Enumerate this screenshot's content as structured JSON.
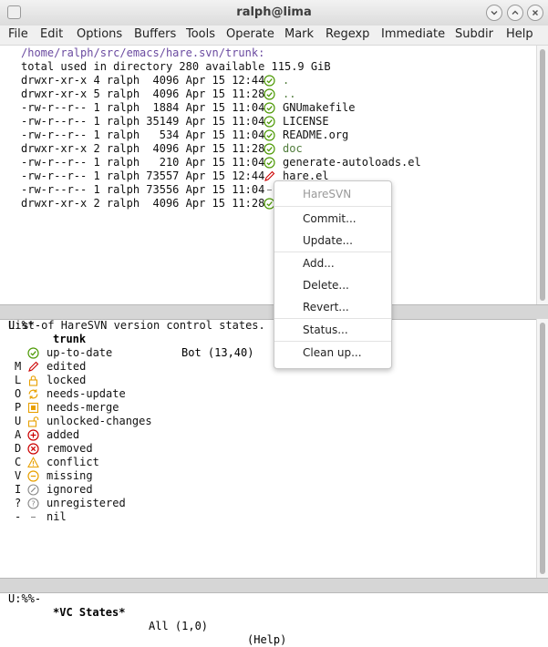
{
  "window": {
    "title": "ralph@lima"
  },
  "menu": [
    "File",
    "Edit",
    "Options",
    "Buffers",
    "Tools",
    "Operate",
    "Mark",
    "Regexp",
    "Immediate",
    "Subdir",
    "Help"
  ],
  "dired": {
    "path": "/home/ralph/src/emacs/hare.svn/trunk:",
    "total": "total used in directory 280 available 115.9 GiB",
    "rows": [
      {
        "info": "drwxr-xr-x 4 ralph  4096 Apr 15 12:44",
        "icon": "up-to-date",
        "name": ".",
        "is_dir": true
      },
      {
        "info": "drwxr-xr-x 5 ralph  4096 Apr 15 11:28",
        "icon": "up-to-date",
        "name": "..",
        "is_dir": true
      },
      {
        "info": "-rw-r--r-- 1 ralph  1884 Apr 15 11:04",
        "icon": "up-to-date",
        "name": "GNUmakefile",
        "is_dir": false
      },
      {
        "info": "-rw-r--r-- 1 ralph 35149 Apr 15 11:04",
        "icon": "up-to-date",
        "name": "LICENSE",
        "is_dir": false
      },
      {
        "info": "-rw-r--r-- 1 ralph   534 Apr 15 11:04",
        "icon": "up-to-date",
        "name": "README.org",
        "is_dir": false
      },
      {
        "info": "drwxr-xr-x 2 ralph  4096 Apr 15 11:28",
        "icon": "up-to-date",
        "name": "doc",
        "is_dir": true
      },
      {
        "info": "-rw-r--r-- 1 ralph   210 Apr 15 11:04",
        "icon": "up-to-date",
        "name": "generate-autoloads.el",
        "is_dir": false
      },
      {
        "info": "-rw-r--r-- 1 ralph 73557 Apr 15 12:44",
        "icon": "edited",
        "name": "hare.el",
        "is_dir": false
      },
      {
        "info": "-rw-r--r-- 1 ralph 73556 Apr 15 11:04",
        "icon": "nil",
        "name": "",
        "is_dir": false
      },
      {
        "info": "drwxr-xr-x 2 ralph  4096 Apr 15 11:28",
        "icon": "up-to-date",
        "name": "",
        "is_dir": true
      }
    ]
  },
  "modeline_top": {
    "status": "U:%*-",
    "buffer": "trunk",
    "position": "Bot (13,40)"
  },
  "states": {
    "header": "List of HareSVN version control states.",
    "items": [
      {
        "code": "",
        "icon": "up-to-date",
        "label": "up-to-date"
      },
      {
        "code": "M",
        "icon": "edited",
        "label": "edited"
      },
      {
        "code": "L",
        "icon": "locked",
        "label": "locked"
      },
      {
        "code": "O",
        "icon": "needs-update",
        "label": "needs-update"
      },
      {
        "code": "P",
        "icon": "needs-merge",
        "label": "needs-merge"
      },
      {
        "code": "U",
        "icon": "unlocked-changes",
        "label": "unlocked-changes"
      },
      {
        "code": "A",
        "icon": "added",
        "label": "added"
      },
      {
        "code": "D",
        "icon": "removed",
        "label": "removed"
      },
      {
        "code": "C",
        "icon": "conflict",
        "label": "conflict"
      },
      {
        "code": "V",
        "icon": "missing",
        "label": "missing"
      },
      {
        "code": "I",
        "icon": "ignored",
        "label": "ignored"
      },
      {
        "code": "?",
        "icon": "unregistered",
        "label": "unregistered"
      },
      {
        "code": "-",
        "icon": "nil",
        "label": "nil"
      }
    ]
  },
  "modeline_bottom": {
    "status": "U:%%-",
    "buffer": "*VC States*",
    "position": "All (1,0)",
    "mode": "(Help)"
  },
  "popup": {
    "title": "HareSVN",
    "items": [
      "Commit...",
      "Update...",
      "Add...",
      "Delete...",
      "Revert...",
      "Status...",
      "Clean up..."
    ]
  },
  "colors": {
    "green": "#4e9a06",
    "red": "#cc0000",
    "orange": "#e8a000",
    "gray": "#888888"
  }
}
